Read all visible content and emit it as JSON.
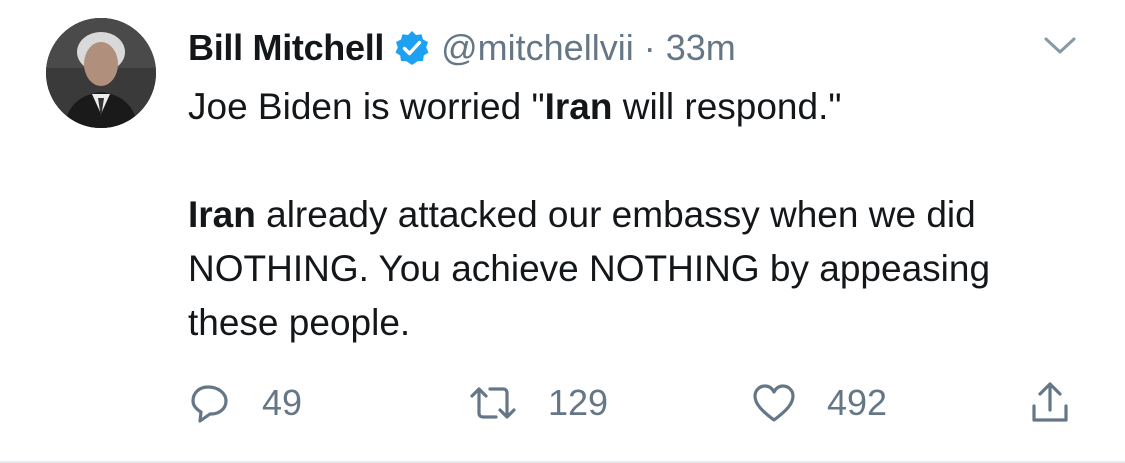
{
  "tweet": {
    "author": {
      "name": "Bill Mitchell",
      "handle": "@mitchellvii",
      "verified_icon": "verified-badge-icon",
      "avatar_icon": "avatar"
    },
    "separator": "·",
    "time": "33m",
    "menu_icon": "chevron-down-icon",
    "body": {
      "line1_pre": "Joe Biden is worried \"",
      "line1_bold": "Iran",
      "line1_post": " will respond.\"",
      "para2_bold": "Iran",
      "para2_rest": " already attacked our embassy when we did NOTHING. You achieve NOTHING by appeasing these people."
    },
    "actions": {
      "reply_count": "49",
      "retweet_count": "129",
      "like_count": "492"
    },
    "colors": {
      "text": "#14171a",
      "secondary": "#657786",
      "verified": "#1da1f2",
      "divider": "#e6ecf0"
    }
  }
}
